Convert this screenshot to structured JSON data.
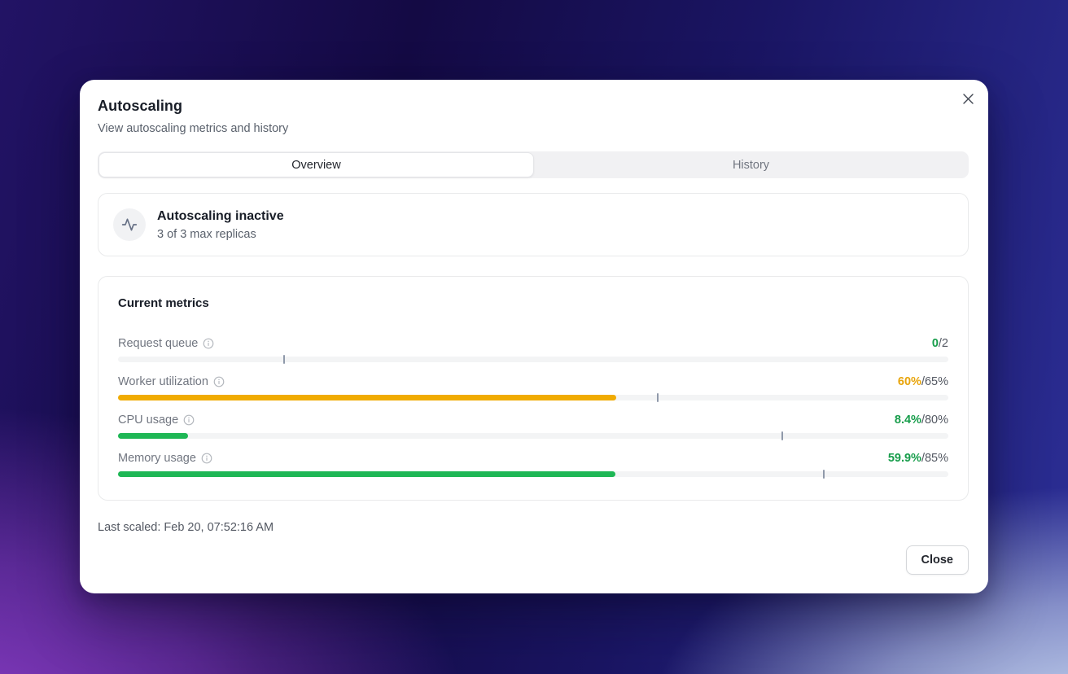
{
  "modal": {
    "title": "Autoscaling",
    "subtitle": "View autoscaling metrics and history"
  },
  "tabs": [
    {
      "label": "Overview",
      "active": true
    },
    {
      "label": "History",
      "active": false
    }
  ],
  "status": {
    "icon": "activity-icon",
    "title": "Autoscaling inactive",
    "subtitle": "3 of 3 max replicas"
  },
  "metrics_card": {
    "title": "Current metrics",
    "metrics": [
      {
        "label": "Request queue",
        "value": "0",
        "threshold": "/2",
        "value_color": "#179d4b",
        "bar_color": "#1eb755",
        "fill_percent": 0,
        "tick_percent": 20
      },
      {
        "label": "Worker utilization",
        "value": "60%",
        "threshold": "/65%",
        "value_color": "#e8a40a",
        "bar_color": "#f0ab02",
        "fill_percent": 60,
        "tick_percent": 65
      },
      {
        "label": "CPU usage",
        "value": "8.4%",
        "threshold": "/80%",
        "value_color": "#179d4b",
        "bar_color": "#1eb755",
        "fill_percent": 8.4,
        "tick_percent": 80
      },
      {
        "label": "Memory usage",
        "value": "59.9%",
        "threshold": "/85%",
        "value_color": "#179d4b",
        "bar_color": "#1eb755",
        "fill_percent": 59.9,
        "tick_percent": 85
      }
    ]
  },
  "footer": {
    "last_scaled": "Last scaled: Feb 20, 07:52:16 AM",
    "close_button": "Close"
  },
  "colors": {
    "green": "#1eb755",
    "amber": "#f0ab02",
    "track": "#f3f4f5",
    "tick": "#8f99aa"
  }
}
